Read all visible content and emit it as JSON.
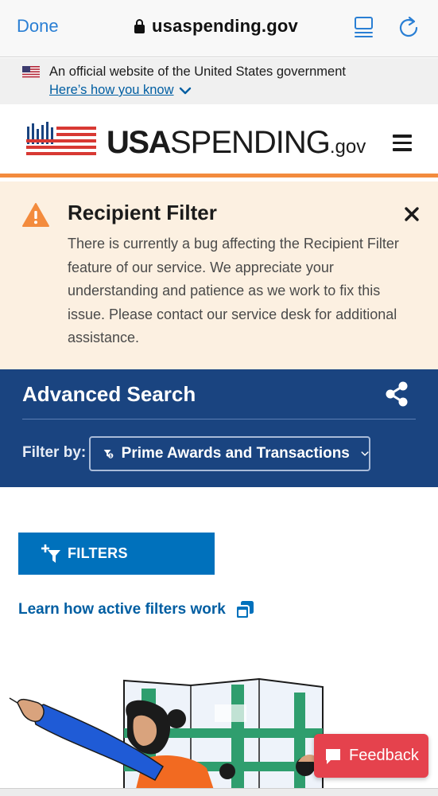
{
  "browser": {
    "done_label": "Done",
    "url": "usaspending.gov",
    "icons": {
      "lock": "lock-icon",
      "tabs": "tabs-icon",
      "reload": "reload-icon"
    }
  },
  "gov_banner": {
    "text": "An official website of the United States government",
    "link": "Here’s how you know"
  },
  "header": {
    "logo_bold": "USA",
    "logo_rest": "SPENDING",
    "logo_suffix": ".gov",
    "brand_colors": {
      "red": "#d83933",
      "navy": "#1a4480",
      "accent": "#f38b3d"
    }
  },
  "alert": {
    "title": "Recipient Filter",
    "body": "There is currently a bug affecting the Recipient Filter feature of our service. We appreciate your understanding and patience as we work to fix this issue. Please contact our service desk for additional assistance.",
    "background": "#fcf0e1",
    "icon_color": "#f38b3d"
  },
  "advanced_search": {
    "title": "Advanced Search",
    "filter_by_label": "Filter by:",
    "selected_option": "Prime Awards and Transactions",
    "background": "#1a4480"
  },
  "filters_button": {
    "label": "FILTERS",
    "color": "#0071bc"
  },
  "learn_link": {
    "label": "Learn how active filters work"
  },
  "feedback": {
    "label": "Feedback",
    "color": "#e5424d"
  }
}
